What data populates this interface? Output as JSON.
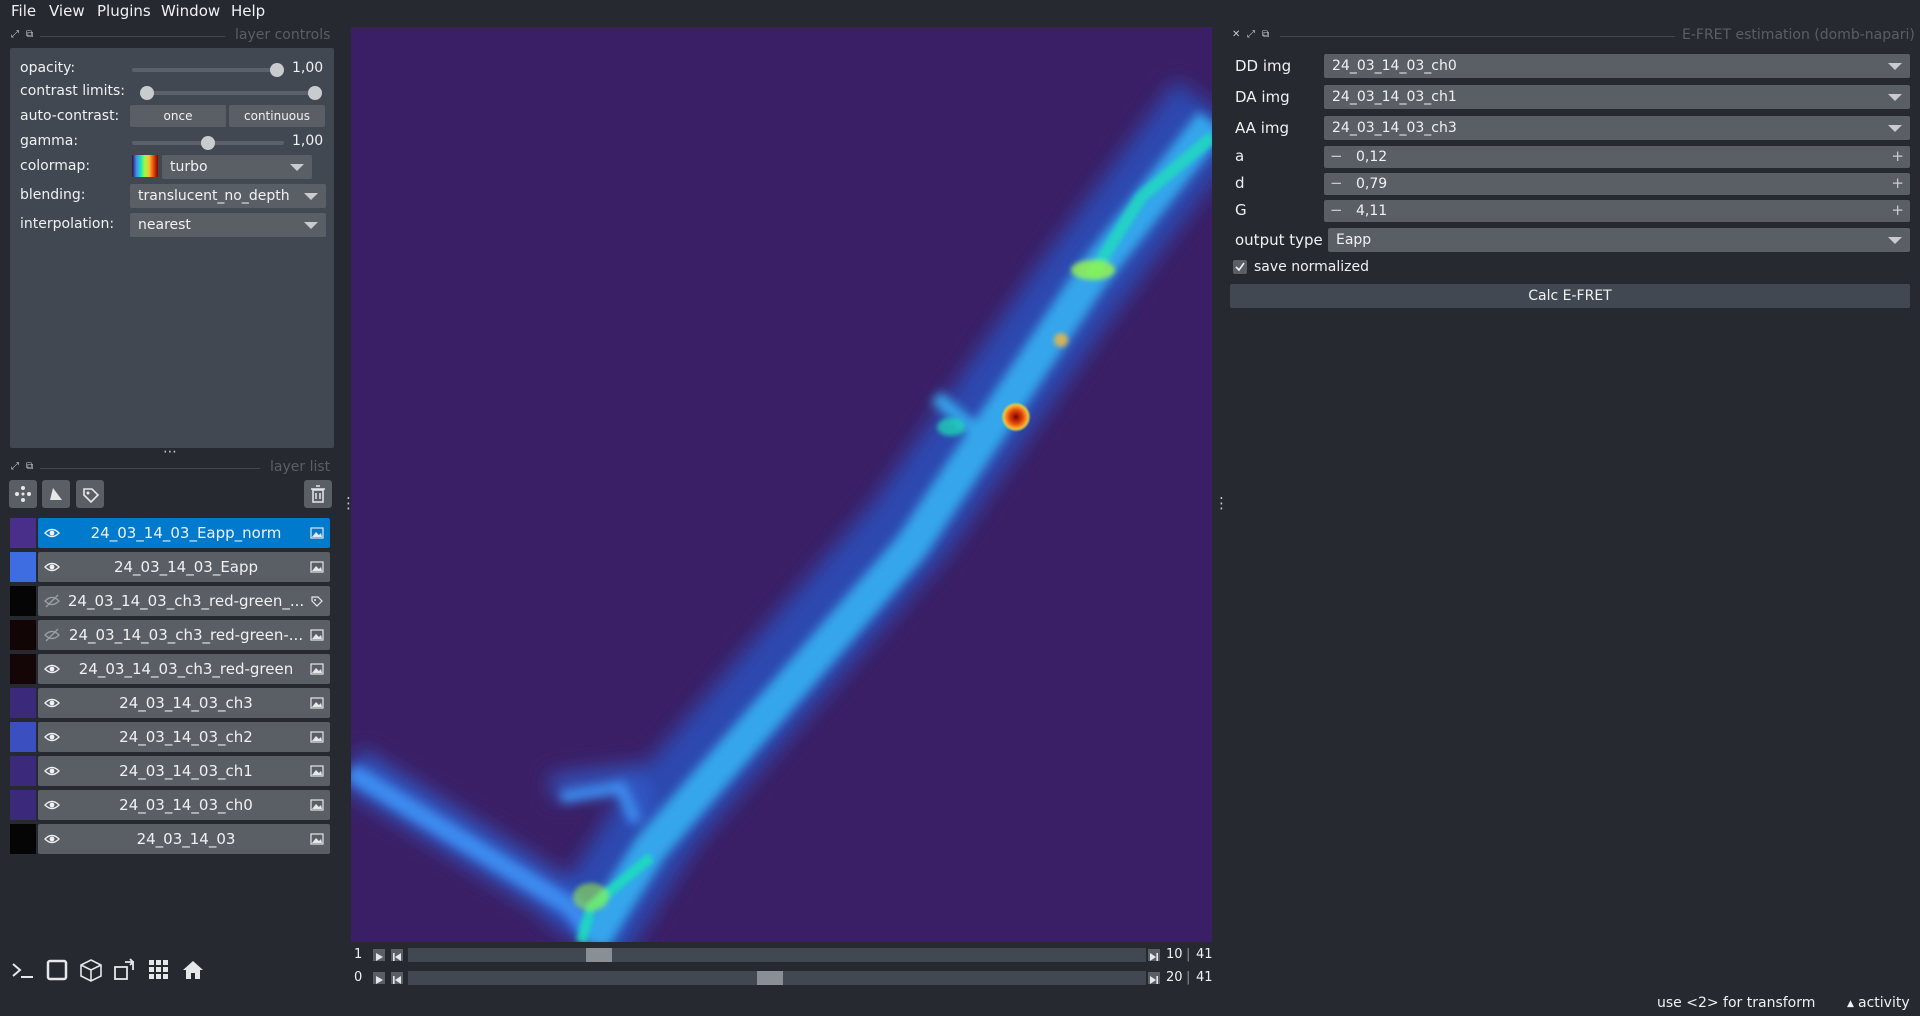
{
  "menu": {
    "items": [
      "File",
      "View",
      "Plugins",
      "Window",
      "Help"
    ]
  },
  "layer_controls": {
    "title": "layer controls",
    "opacity_label": "opacity:",
    "opacity_value": "1,00",
    "opacity_level": 1.0,
    "contrast_label": "contrast limits:",
    "contrast_range": [
      0.0,
      1.0
    ],
    "autocontrast_label": "auto-contrast:",
    "once_label": "once",
    "continuous_label": "continuous",
    "gamma_label": "gamma:",
    "gamma_value": "1,00",
    "gamma_level": 0.5,
    "colormap_label": "colormap:",
    "colormap_value": "turbo",
    "blending_label": "blending:",
    "blending_value": "translucent_no_depth",
    "interpolation_label": "interpolation:",
    "interpolation_value": "nearest"
  },
  "layer_list": {
    "title": "layer list",
    "tool_icons": [
      "points-icon",
      "shapes-icon",
      "labels-icon"
    ],
    "delete_icon": "trash-icon",
    "layers": [
      {
        "name": "24_03_14_03_Eapp_norm",
        "selected": true,
        "visible": true,
        "type": "image",
        "thumb": "#4a2f8a"
      },
      {
        "name": "24_03_14_03_Eapp",
        "selected": false,
        "visible": true,
        "type": "image",
        "thumb": "#3d6de0"
      },
      {
        "name": "24_03_14_03_ch3_red-green_...",
        "selected": false,
        "visible": false,
        "type": "labels",
        "thumb": "#050505"
      },
      {
        "name": "24_03_14_03_ch3_red-green-...",
        "selected": false,
        "visible": false,
        "type": "image",
        "thumb": "#120505"
      },
      {
        "name": "24_03_14_03_ch3_red-green",
        "selected": false,
        "visible": true,
        "type": "image",
        "thumb": "#140606"
      },
      {
        "name": "24_03_14_03_ch3",
        "selected": false,
        "visible": true,
        "type": "image",
        "thumb": "#3b2a7a"
      },
      {
        "name": "24_03_14_03_ch2",
        "selected": false,
        "visible": true,
        "type": "image",
        "thumb": "#3b4fc0"
      },
      {
        "name": "24_03_14_03_ch1",
        "selected": false,
        "visible": true,
        "type": "image",
        "thumb": "#3b2a7a"
      },
      {
        "name": "24_03_14_03_ch0",
        "selected": false,
        "visible": true,
        "type": "image",
        "thumb": "#3b2a7a"
      },
      {
        "name": "24_03_14_03",
        "selected": false,
        "visible": true,
        "type": "image",
        "thumb": "#050505"
      }
    ]
  },
  "bottom_buttons": [
    "console-icon",
    "ndisplay-icon",
    "3d-cube-icon",
    "transpose-icon",
    "grid-icon",
    "home-icon"
  ],
  "dims": [
    {
      "axis": "1",
      "current": "10",
      "total": "41",
      "position": 0.25
    },
    {
      "axis": "0",
      "current": "20",
      "total": "41",
      "position": 0.49
    }
  ],
  "plugin": {
    "title": "E-FRET estimation (domb-napari)",
    "dd_label": "DD img",
    "dd_value": "24_03_14_03_ch0",
    "da_label": "DA img",
    "da_value": "24_03_14_03_ch1",
    "aa_label": "AA img",
    "aa_value": "24_03_14_03_ch3",
    "a_label": "a",
    "a_value": "0,12",
    "d_label": "d",
    "d_value": "0,79",
    "g_label": "G",
    "g_value": "4,11",
    "output_label": "output type",
    "output_value": "Eapp",
    "save_label": "save normalized",
    "save_checked": true,
    "calc_label": "Calc E-FRET"
  },
  "status": {
    "hint": "use <2> for transform",
    "activity": "activity"
  }
}
